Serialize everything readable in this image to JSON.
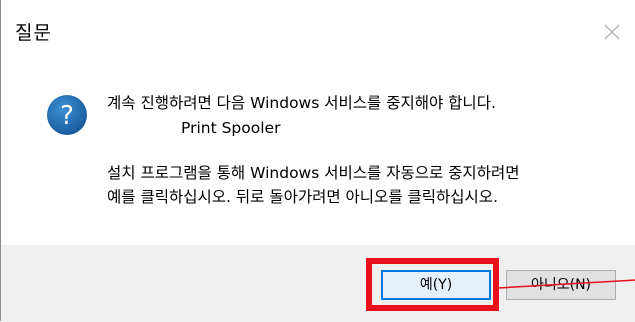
{
  "window": {
    "title": "질문",
    "close_glyph": "✕"
  },
  "message": {
    "line1": "계속 진행하려면 다음 Windows 서비스를 중지해야 합니다.",
    "service_name": "Print Spooler",
    "line3": "설치 프로그램을 통해 Windows 서비스를 자동으로 중지하려면",
    "line4": "예를 클릭하십시오. 뒤로 돌아가려면 아니오를 클릭하십시오."
  },
  "buttons": {
    "yes_label": "예(Y)",
    "no_label": "아니오(N)"
  },
  "icon": {
    "name": "question-icon",
    "glyph": "?"
  },
  "colors": {
    "icon_blue": "#1f6fb5",
    "highlight_red": "#e8101a",
    "default_button_border": "#0078d7"
  }
}
